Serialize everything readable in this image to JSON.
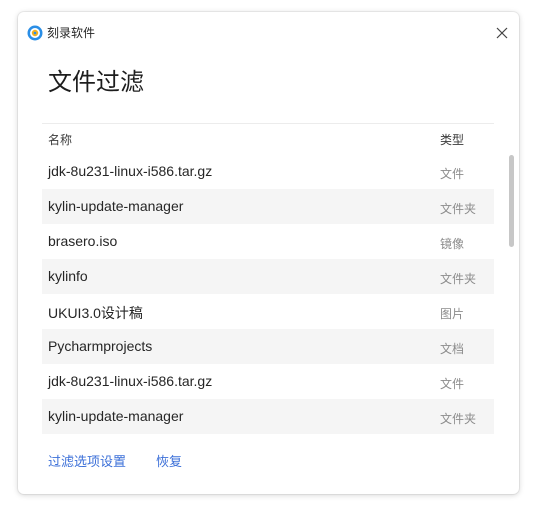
{
  "window": {
    "app_name": "刻录软件",
    "title": "文件过滤",
    "icon": "disc-burner-icon",
    "close_icon": "close-icon"
  },
  "colors": {
    "accent": "#3b6fd8",
    "row_alt": "#f5f5f5",
    "text": "#262626",
    "muted": "#8c8c8c"
  },
  "table": {
    "headers": {
      "name": "名称",
      "type": "类型"
    },
    "rows": [
      {
        "name": "jdk-8u231-linux-i586.tar.gz",
        "type": "文件"
      },
      {
        "name": "kylin-update-manager",
        "type": "文件夹"
      },
      {
        "name": "brasero.iso",
        "type": "镜像"
      },
      {
        "name": "kylinfo",
        "type": "文件夹"
      },
      {
        "name": "UKUI3.0设计稿",
        "type": "图片"
      },
      {
        "name": "Pycharmprojects",
        "type": "文档"
      },
      {
        "name": "jdk-8u231-linux-i586.tar.gz",
        "type": "文件"
      },
      {
        "name": "kylin-update-manager",
        "type": "文件夹"
      }
    ]
  },
  "footer": {
    "filter_settings_label": "过滤选项设置",
    "restore_label": "恢复"
  }
}
